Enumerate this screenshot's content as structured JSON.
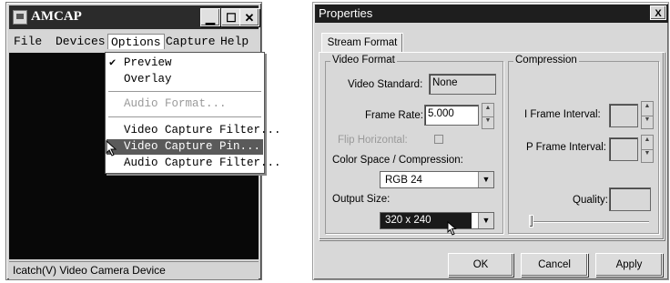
{
  "amcap": {
    "title": "AMCAP",
    "menu": {
      "file": "File",
      "devices": "Devices",
      "options": "Options",
      "capture": "Capture",
      "help": "Help"
    },
    "status": "Icatch(V) Video Camera Device",
    "options_menu": {
      "preview": "Preview",
      "preview_checked": "✔",
      "overlay": "Overlay",
      "audio_format": "Audio Format...",
      "video_capture_filter": "Video Capture Filter...",
      "video_capture_pin": "Video Capture Pin...",
      "audio_capture_filter": "Audio Capture Filter..."
    }
  },
  "properties": {
    "title": "Properties",
    "close_glyph": "X",
    "tab": "Stream Format",
    "video_format": {
      "group_label": "Video Format",
      "video_standard_label": "Video Standard:",
      "video_standard_value": "None",
      "frame_rate_label": "Frame Rate:",
      "frame_rate_value": "5.000",
      "flip_horizontal_label": "Flip Horizontal:",
      "color_space_label": "Color Space / Compression:",
      "color_space_value": "RGB 24",
      "output_size_label": "Output Size:",
      "output_size_value": "320 x 240"
    },
    "compression": {
      "group_label": "Compression",
      "i_frame_label": "I Frame Interval:",
      "p_frame_label": "P Frame Interval:",
      "quality_label": "Quality:"
    },
    "buttons": {
      "ok": "OK",
      "cancel": "Cancel",
      "apply": "Apply"
    }
  }
}
